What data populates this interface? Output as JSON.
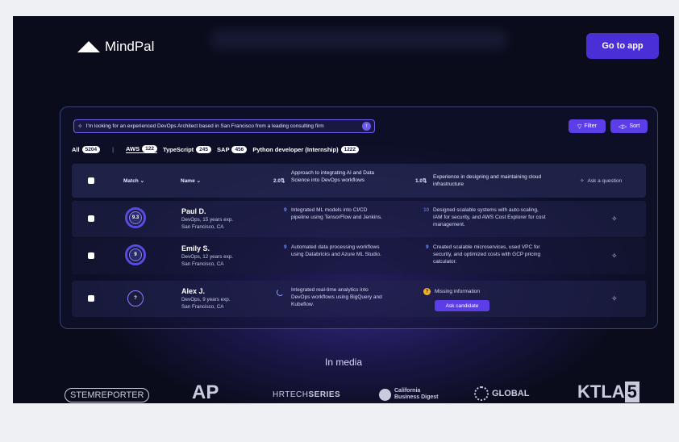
{
  "header": {
    "brand": "MindPal",
    "go_to_app": "Go to app"
  },
  "search": {
    "value": "I'm looking for an experienced DevOps Architect based in San Francisco from a leading consulting firm"
  },
  "toolbar": {
    "filter": "Filter",
    "sort": "Sort"
  },
  "tabs": [
    {
      "label": "All",
      "count": "5204"
    },
    {
      "label": "AWS",
      "count": "122"
    },
    {
      "label": "TypeScript",
      "count": "245"
    },
    {
      "label": "SAP",
      "count": "456"
    },
    {
      "label": "Python developer (Internship)",
      "count": "1222"
    }
  ],
  "table": {
    "headers": {
      "match": "Match",
      "name": "Name",
      "crit1_score": "2.0",
      "crit1": "Approach to integrating AI and Data Science into DevOps workflows",
      "crit2_score": "1.0",
      "crit2": "Experience in designing and maintaining cloud infrastructure",
      "ask": "Ask a question"
    },
    "rows": [
      {
        "match": "9.3",
        "name": "Paul D.",
        "meta1": "DevOps, 15 years exp.",
        "meta2": "San Francisco, CA",
        "c1_score": "9",
        "c1": "Integrated ML models into CI/CD pipeline using TensorFlow and Jenkins.",
        "c2_score": "10",
        "c2": "Designed scalable systems with auto-scaling, IAM for security, and AWS Cost Explorer for cost management."
      },
      {
        "match": "9",
        "name": "Emily S.",
        "meta1": "DevOps, 12 years exp.",
        "meta2": "San Francisco, CA",
        "c1_score": "9",
        "c1": "Automated data processing workflows using Databricks and Azure ML Studio.",
        "c2_score": "9",
        "c2": "Created scalable microservices, used VPC for security, and optimized costs with GCP pricing calculator."
      },
      {
        "match": "?",
        "name": "Alex J.",
        "meta1": "DevOps, 9 years exp.",
        "meta2": "San Francisco, CA",
        "c1": "Integrated real-time analytics into DevOps workflows using BigQuery and Kubeflow.",
        "c2_warn": "?",
        "c2": "Missing information",
        "ask_candidate": "Ask candidate"
      }
    ]
  },
  "media": {
    "title": "In media",
    "logos": {
      "stem": "STEMREPORTER",
      "ap": "AP",
      "hr_light": "HRTECH",
      "hr_bold": "SERIES",
      "cal1": "California",
      "cal2": "Business Digest",
      "global": "GLOBAL",
      "ktla": "KTLA",
      "ktla_num": "5"
    }
  }
}
